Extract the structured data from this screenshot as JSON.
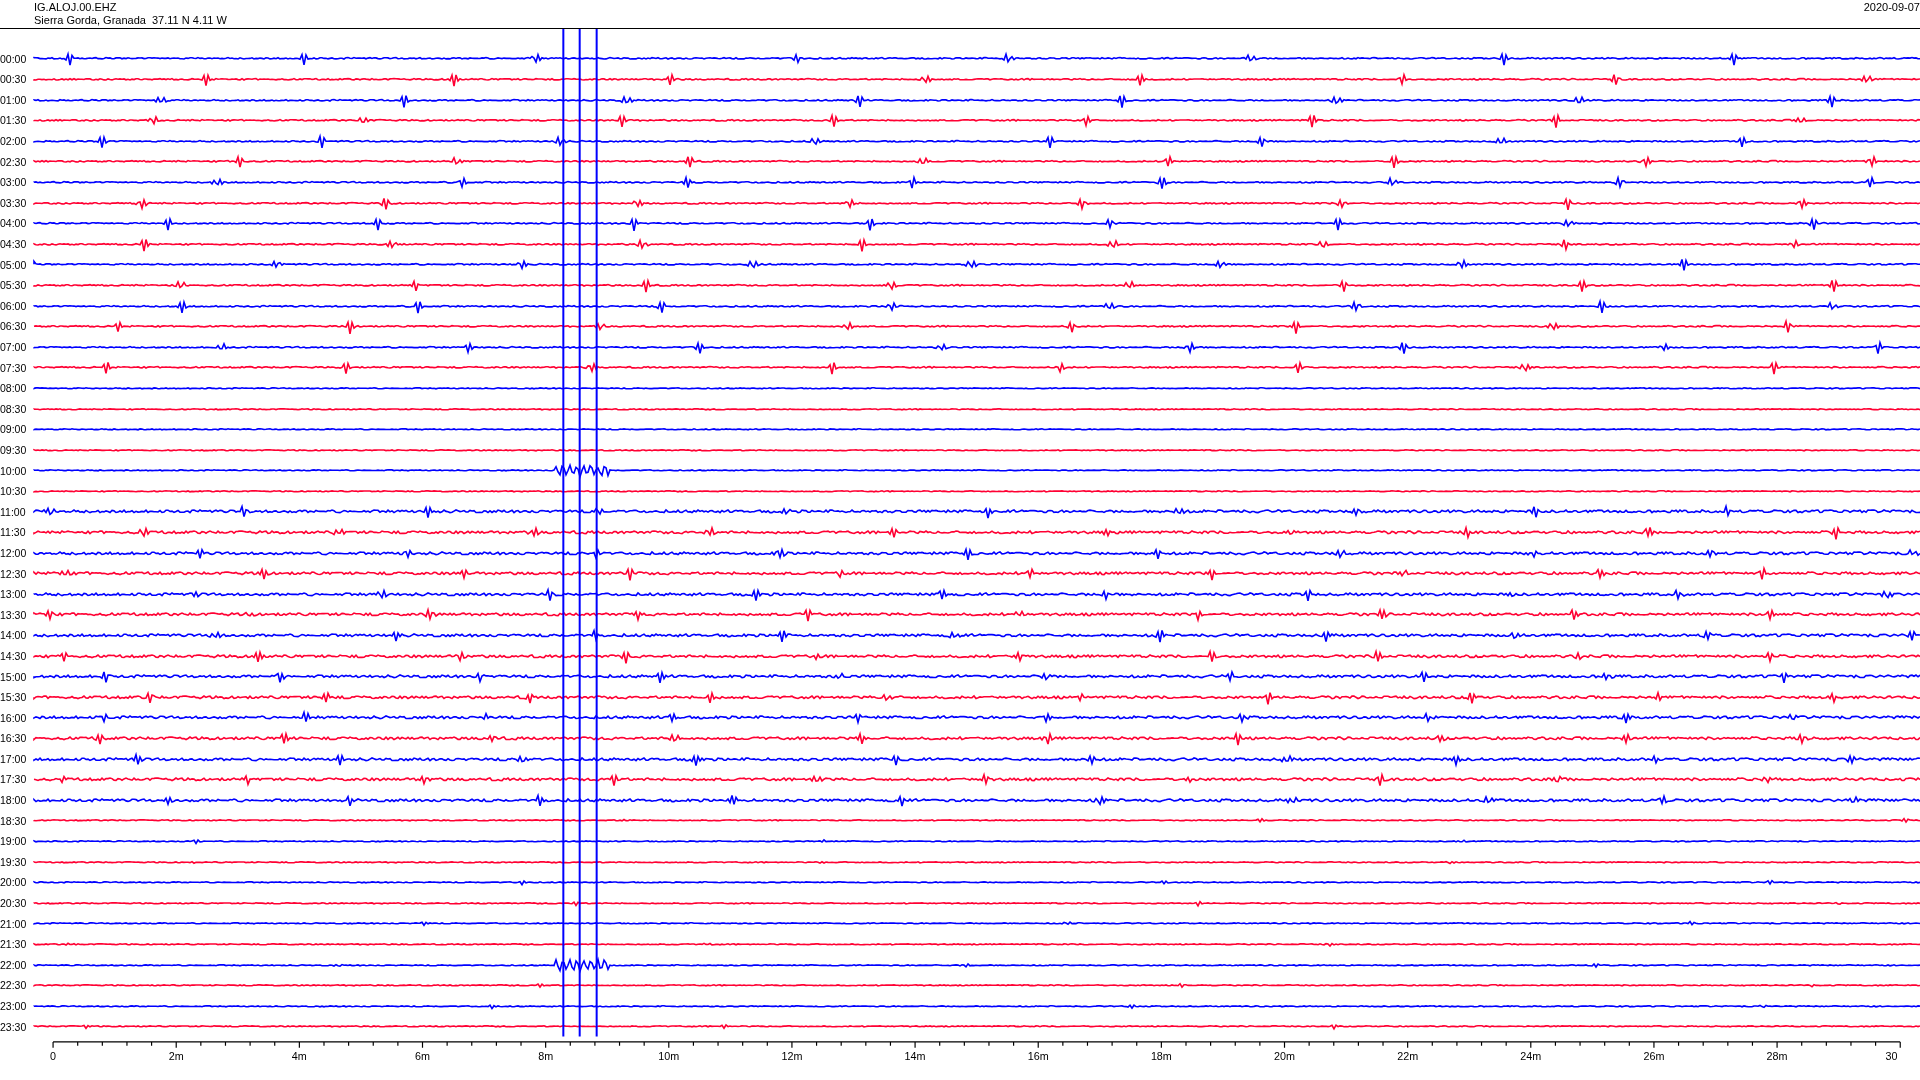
{
  "header": {
    "station": "IG.ALOJ.00.EHZ",
    "location": "Sierra Gorda, Granada  37.11 N 4.11 W",
    "date": "2020-09-07"
  },
  "rows": [
    {
      "label": "00:00",
      "color": "#0000ff"
    },
    {
      "label": "00:30",
      "color": "#ff0033"
    },
    {
      "label": "01:00",
      "color": "#0000ff"
    },
    {
      "label": "01:30",
      "color": "#ff0033"
    },
    {
      "label": "02:00",
      "color": "#0000ff"
    },
    {
      "label": "02:30",
      "color": "#ff0033"
    },
    {
      "label": "03:00",
      "color": "#0000ff"
    },
    {
      "label": "03:30",
      "color": "#ff0033"
    },
    {
      "label": "04:00",
      "color": "#0000ff"
    },
    {
      "label": "04:30",
      "color": "#ff0033"
    },
    {
      "label": "05:00",
      "color": "#0000ff"
    },
    {
      "label": "05:30",
      "color": "#ff0033"
    },
    {
      "label": "06:00",
      "color": "#0000ff"
    },
    {
      "label": "06:30",
      "color": "#ff0033"
    },
    {
      "label": "07:00",
      "color": "#0000ff"
    },
    {
      "label": "07:30",
      "color": "#ff0033"
    },
    {
      "label": "08:00",
      "color": "#0000ff"
    },
    {
      "label": "08:30",
      "color": "#ff0033"
    },
    {
      "label": "09:00",
      "color": "#0000ff"
    },
    {
      "label": "09:30",
      "color": "#ff0033"
    },
    {
      "label": "10:00",
      "color": "#0000ff"
    },
    {
      "label": "10:30",
      "color": "#ff0033"
    },
    {
      "label": "11:00",
      "color": "#0000ff"
    },
    {
      "label": "11:30",
      "color": "#ff0033"
    },
    {
      "label": "12:00",
      "color": "#0000ff"
    },
    {
      "label": "12:30",
      "color": "#ff0033"
    },
    {
      "label": "13:00",
      "color": "#0000ff"
    },
    {
      "label": "13:30",
      "color": "#ff0033"
    },
    {
      "label": "14:00",
      "color": "#0000ff"
    },
    {
      "label": "14:30",
      "color": "#ff0033"
    },
    {
      "label": "15:00",
      "color": "#0000ff"
    },
    {
      "label": "15:30",
      "color": "#ff0033"
    },
    {
      "label": "16:00",
      "color": "#0000ff"
    },
    {
      "label": "16:30",
      "color": "#ff0033"
    },
    {
      "label": "17:00",
      "color": "#0000ff"
    },
    {
      "label": "17:30",
      "color": "#ff0033"
    },
    {
      "label": "18:00",
      "color": "#0000ff"
    },
    {
      "label": "18:30",
      "color": "#ff0033"
    },
    {
      "label": "19:00",
      "color": "#0000ff"
    },
    {
      "label": "19:30",
      "color": "#ff0033"
    },
    {
      "label": "20:00",
      "color": "#0000ff"
    },
    {
      "label": "20:30",
      "color": "#ff0033"
    },
    {
      "label": "21:00",
      "color": "#0000ff"
    },
    {
      "label": "21:30",
      "color": "#ff0033"
    },
    {
      "label": "22:00",
      "color": "#0000ff"
    },
    {
      "label": "22:30",
      "color": "#ff0033"
    },
    {
      "label": "23:00",
      "color": "#0000ff"
    },
    {
      "label": "23:30",
      "color": "#ff0033"
    }
  ],
  "axis": {
    "ticks": [
      "0",
      "2m",
      "4m",
      "6m",
      "8m",
      "10m",
      "12m",
      "14m",
      "16m",
      "18m",
      "20m",
      "22m",
      "24m",
      "26m",
      "28m",
      "30"
    ]
  }
}
